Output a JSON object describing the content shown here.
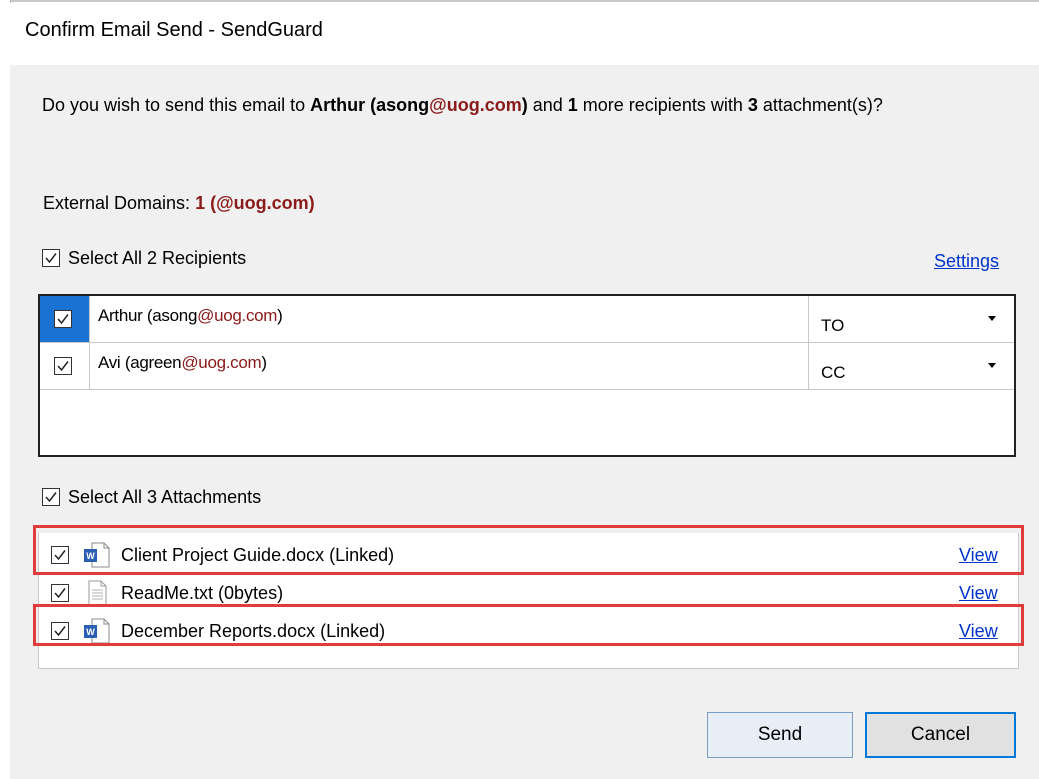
{
  "window": {
    "title": "Confirm Email Send - SendGuard"
  },
  "prompt": {
    "p1": "Do you wish to send this email to ",
    "recipient_name": "Arthur",
    "p2": " (asong",
    "domain": "@uog.com",
    "p3": ")",
    "p4": " and ",
    "more_count": "1",
    "p5": " more recipients with ",
    "attach_count": "3",
    "p6": " attachment(s)?"
  },
  "external": {
    "label": "External Domains: ",
    "count": "1",
    "domains": " (@uog.com)"
  },
  "recipients": {
    "select_all_label": "Select All 2 Recipients",
    "settings_label": "Settings",
    "items": [
      {
        "name_prefix": "Arthur (asong",
        "domain": "@uog.com",
        "name_suffix": ")",
        "type": "TO",
        "checked": true
      },
      {
        "name_prefix": "Avi (agreen",
        "domain": "@uog.com",
        "name_suffix": ")",
        "type": "CC",
        "checked": true
      }
    ]
  },
  "attachments": {
    "select_all_label": "Select All 3 Attachments",
    "view_label": "View",
    "items": [
      {
        "name": "Client Project Guide.docx (Linked)",
        "icon": "word-doc-icon",
        "highlighted": true
      },
      {
        "name": "ReadMe.txt (0bytes)",
        "icon": "text-file-icon",
        "highlighted": false
      },
      {
        "name": "December Reports.docx (Linked)",
        "icon": "word-doc-icon",
        "highlighted": true
      }
    ]
  },
  "buttons": {
    "send": "Send",
    "cancel": "Cancel"
  },
  "colors": {
    "domain": "#8b1a1a",
    "link": "#0033cc",
    "highlight": "#e03c3c",
    "selected_cell": "#1a73d2"
  }
}
